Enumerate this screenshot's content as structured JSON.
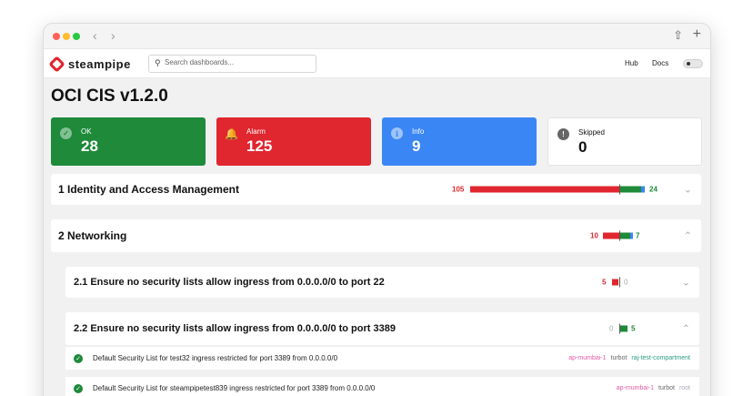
{
  "app": {
    "brand": "steampipe",
    "search_placeholder": "Search dashboards...",
    "nav": {
      "hub": "Hub",
      "docs": "Docs"
    }
  },
  "page": {
    "title": "OCI CIS v1.2.0"
  },
  "summary": [
    {
      "label": "OK",
      "value": "28",
      "color": "#1e8a3a",
      "icon": "check-circle-icon"
    },
    {
      "label": "Alarm",
      "value": "125",
      "color": "#e0262f",
      "icon": "bell-icon"
    },
    {
      "label": "Info",
      "value": "9",
      "color": "#3b86f5",
      "icon": "info-circle-icon"
    },
    {
      "label": "Skipped",
      "value": "0",
      "color": "#ffffff",
      "icon": "exclamation-circle-icon"
    }
  ],
  "sections": [
    {
      "title": "1 Identity and Access Management",
      "alarm": "105",
      "ok": "24",
      "expanded": false
    },
    {
      "title": "2 Networking",
      "alarm": "10",
      "ok": "7",
      "expanded": true
    }
  ],
  "subsections": [
    {
      "title": "2.1 Ensure no security lists allow ingress from 0.0.0.0/0 to port 22",
      "alarm": "5",
      "ok": "0",
      "expanded": false
    },
    {
      "title": "2.2 Ensure no security lists allow ingress from 0.0.0.0/0 to port 3389",
      "alarm": "0",
      "ok": "5",
      "expanded": true
    }
  ],
  "results": [
    {
      "text": "Default Security List for test32 ingress restricted for port 3389 from 0.0.0.0/0",
      "region": "ap-mumbai-1",
      "account": "turbot",
      "compartment": "raj-test-compartment"
    },
    {
      "text": "Default Security List for steampipetest839 ingress restricted for port 3389 from 0.0.0.0/0",
      "region": "ap-mumbai-1",
      "account": "turbot",
      "compartment": "root"
    }
  ]
}
